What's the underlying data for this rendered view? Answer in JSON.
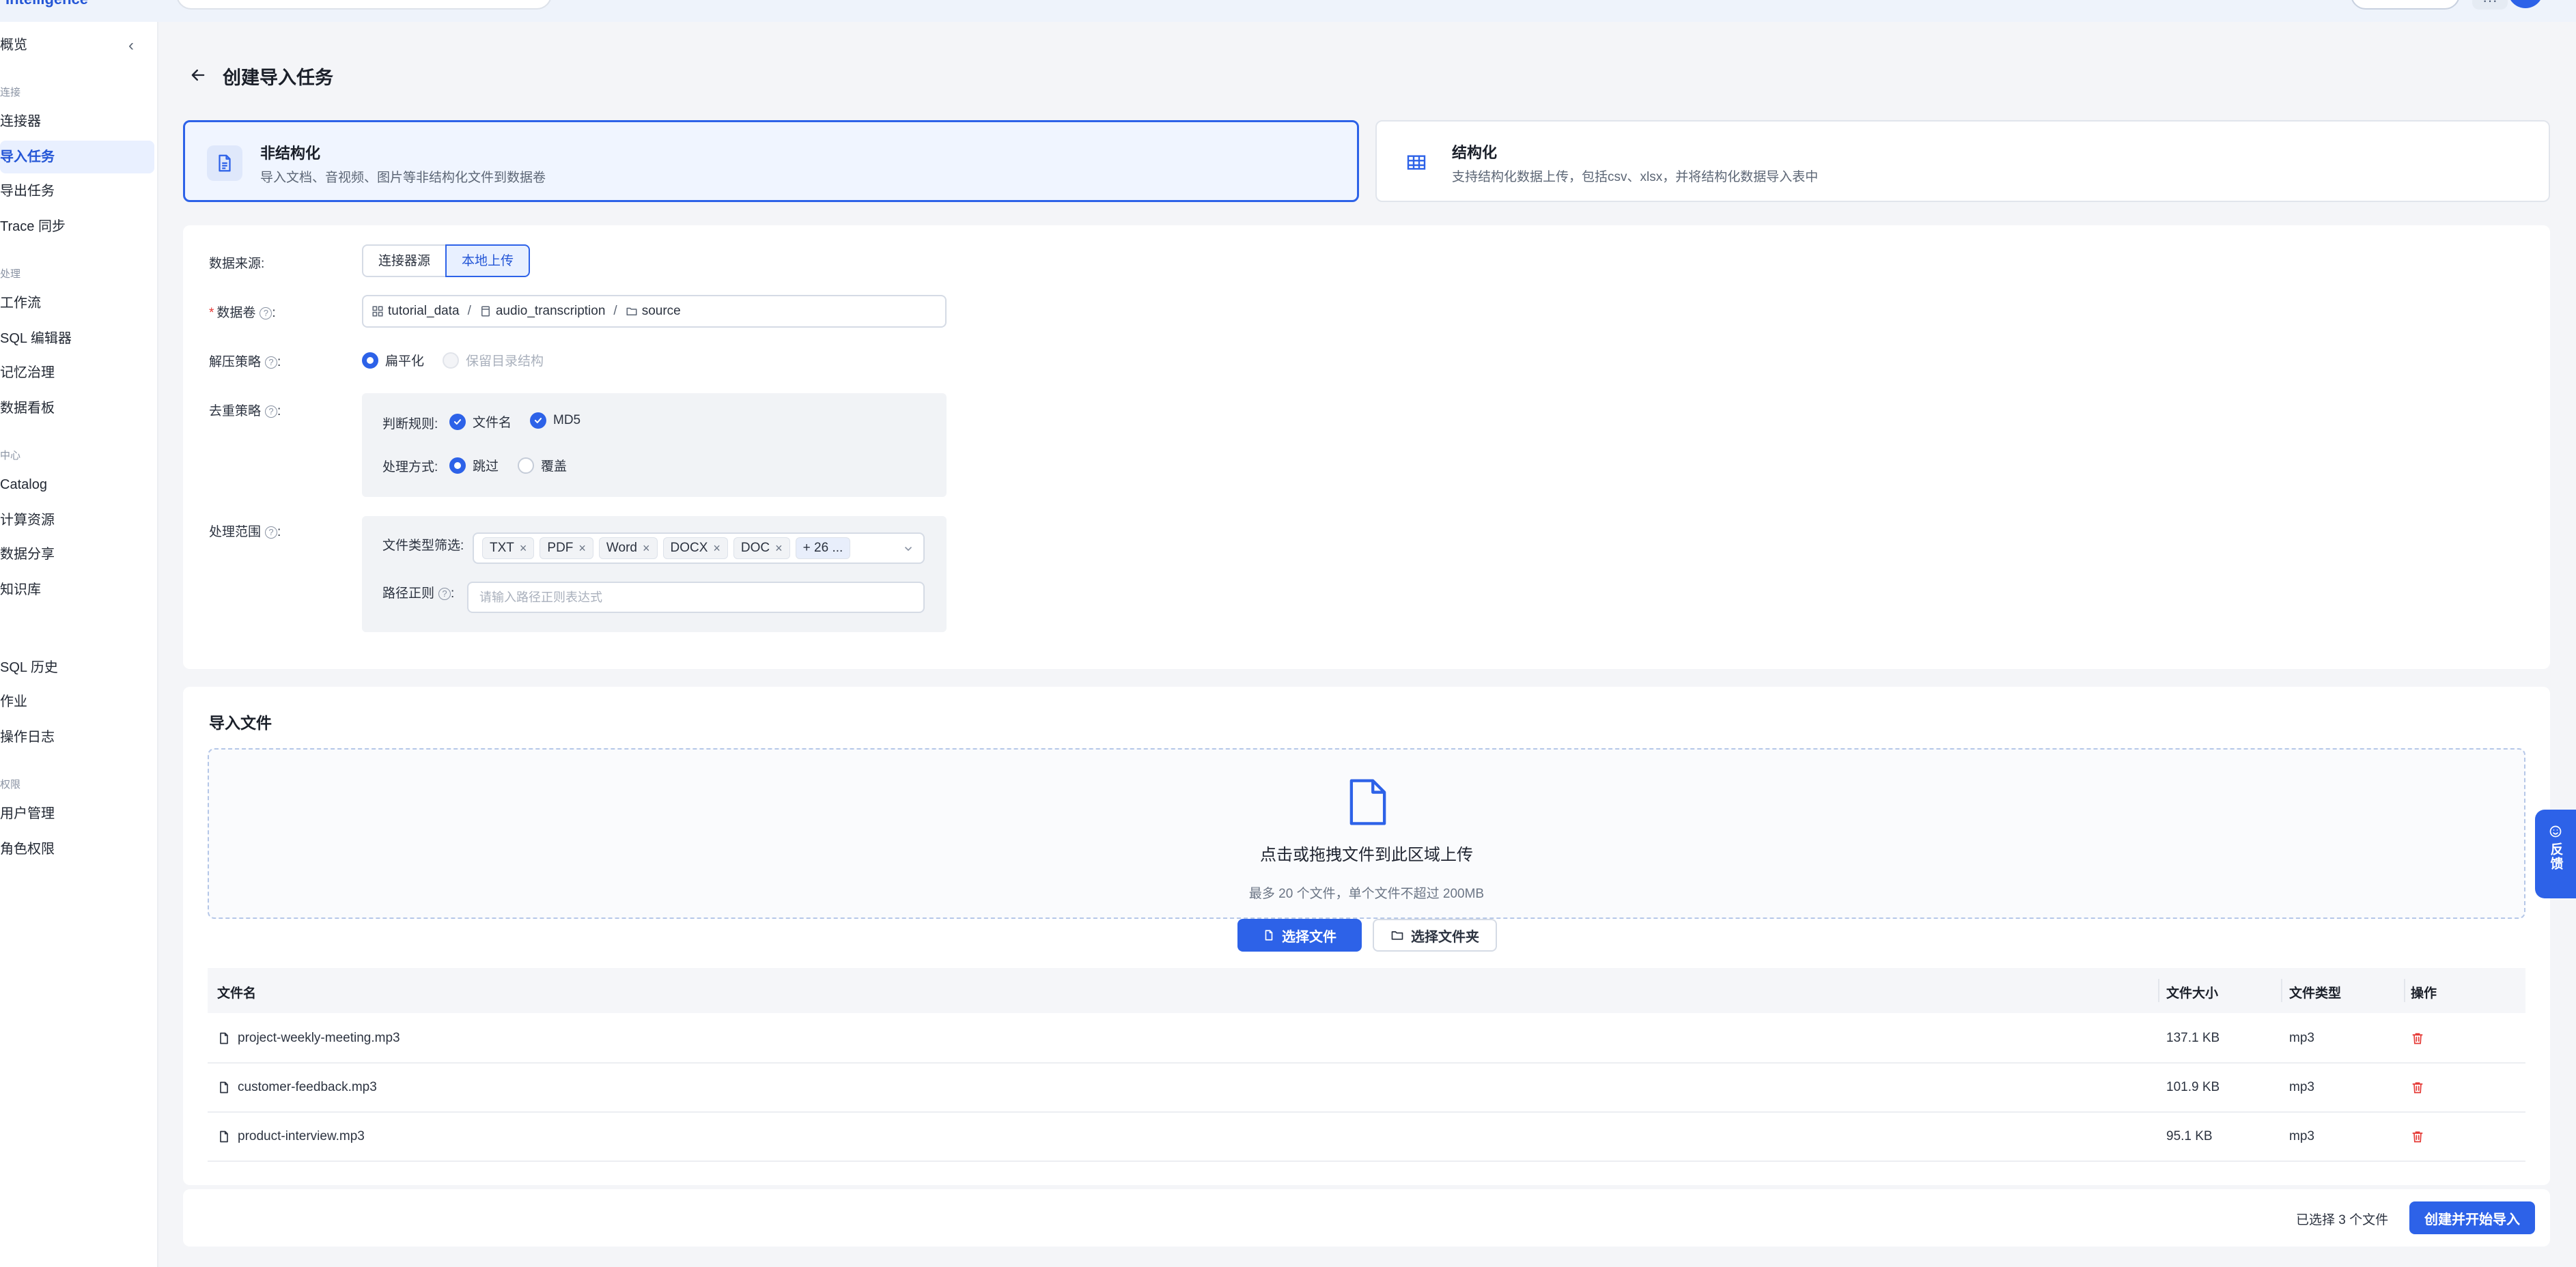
{
  "brand": {
    "name": "Intelligence"
  },
  "sidebar": {
    "overview": "概览",
    "groups": [
      {
        "title": "连接",
        "items": [
          "连接器",
          "导入任务",
          "导出任务",
          "Trace 同步"
        ]
      },
      {
        "title": "处理",
        "items": [
          "工作流",
          "SQL 编辑器",
          "记忆治理",
          "数据看板"
        ]
      },
      {
        "title": "中心",
        "items": [
          "Catalog",
          "计算资源",
          "数据分享",
          "知识库"
        ]
      },
      {
        "title": "",
        "items": [
          "SQL 历史",
          "作业",
          "操作日志"
        ]
      },
      {
        "title": "权限",
        "items": [
          "用户管理",
          "角色权限"
        ]
      }
    ],
    "active": "导入任务"
  },
  "page": {
    "title": "创建导入任务"
  },
  "type_cards": [
    {
      "title": "非结构化",
      "desc": "导入文档、音视频、图片等非结构化文件到数据卷",
      "selected": true
    },
    {
      "title": "结构化",
      "desc": "支持结构化数据上传，包括csv、xlsx，并将结构化数据导入表中",
      "selected": false
    }
  ],
  "form": {
    "source": {
      "label": "数据来源:",
      "options": [
        "连接器源",
        "本地上传"
      ],
      "selected": "本地上传"
    },
    "volume": {
      "label": "数据卷",
      "path": [
        "tutorial_data",
        "audio_transcription",
        "source"
      ],
      "sep": "/"
    },
    "unzip": {
      "label": "解压策略",
      "options": [
        "扁平化",
        "保留目录结构"
      ],
      "selected": "扁平化"
    },
    "dedup": {
      "label": "去重策略",
      "rule_label": "判断规则:",
      "rules": [
        "文件名",
        "MD5"
      ],
      "mode_label": "处理方式:",
      "modes": [
        "跳过",
        "覆盖"
      ],
      "mode_selected": "跳过"
    },
    "scope": {
      "label": "处理范围",
      "filter_label": "文件类型筛选:",
      "tags": [
        "TXT",
        "PDF",
        "Word",
        "DOCX",
        "DOC"
      ],
      "more": "+ 26 ...",
      "regex_label": "路径正则",
      "regex_placeholder": "请输入路径正则表达式"
    }
  },
  "upload": {
    "section_title": "导入文件",
    "drop_text": "点击或拖拽文件到此区域上传",
    "drop_hint": "最多 20 个文件，单个文件不超过 200MB",
    "choose_file": "选择文件",
    "choose_folder": "选择文件夹"
  },
  "table": {
    "columns": [
      "文件名",
      "文件大小",
      "文件类型",
      "操作"
    ],
    "rows": [
      {
        "name": "project-weekly-meeting.mp3",
        "size": "137.1 KB",
        "type": "mp3"
      },
      {
        "name": "customer-feedback.mp3",
        "size": "101.9 KB",
        "type": "mp3"
      },
      {
        "name": "product-interview.mp3",
        "size": "95.1 KB",
        "type": "mp3"
      }
    ]
  },
  "footer": {
    "selected_count": "已选择 3 个文件",
    "submit": "创建并开始导入"
  },
  "feedback": {
    "label": "反馈"
  },
  "colors": {
    "primary": "#2d62e8",
    "danger": "#e53935"
  }
}
